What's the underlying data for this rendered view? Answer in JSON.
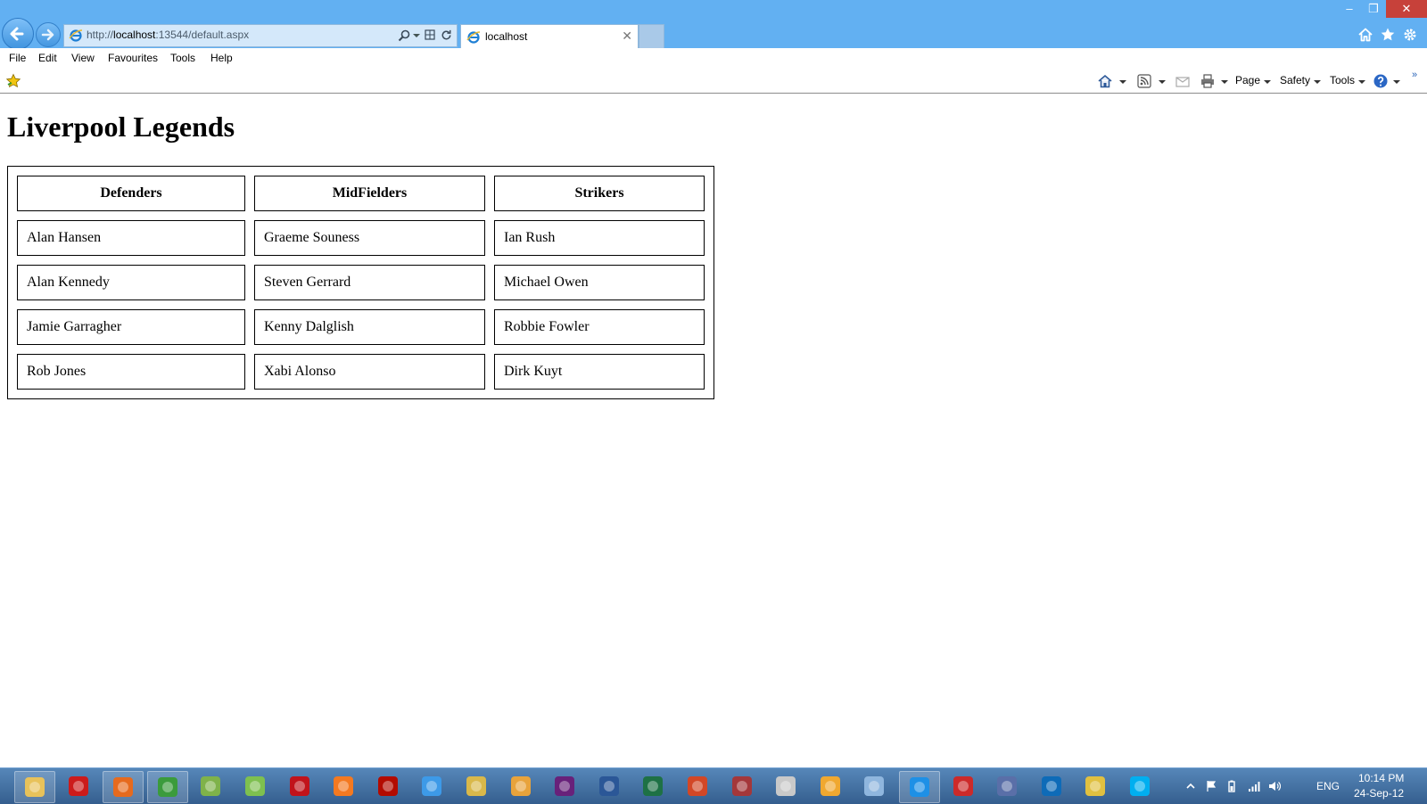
{
  "browser": {
    "address_scheme": "http://",
    "address_host": "localhost",
    "address_rest": ":13544/default.aspx",
    "tab_title": "localhost"
  },
  "menu": {
    "items": [
      {
        "label": "File"
      },
      {
        "label": "Edit"
      },
      {
        "label": "View"
      },
      {
        "label": "Favourites"
      },
      {
        "label": "Tools"
      },
      {
        "label": "Help"
      }
    ]
  },
  "commandbar": {
    "page_label": "Page",
    "safety_label": "Safety",
    "tools_label": "Tools"
  },
  "page": {
    "title": "Liverpool Legends",
    "table": {
      "headers": [
        "Defenders",
        "MidFielders",
        "Strikers"
      ],
      "rows": [
        [
          "Alan Hansen",
          "Graeme Souness",
          "Ian Rush"
        ],
        [
          "Alan Kennedy",
          "Steven Gerrard",
          "Michael Owen"
        ],
        [
          "Jamie Garragher",
          "Kenny Dalglish",
          "Robbie Fowler"
        ],
        [
          "Rob Jones",
          "Xabi Alonso",
          "Dirk Kuyt"
        ]
      ]
    }
  },
  "taskbar": {
    "apps": [
      {
        "name": "file-explorer-icon",
        "color": "#e8c25a",
        "running": true
      },
      {
        "name": "opera-icon",
        "color": "#cc1b1b",
        "running": false
      },
      {
        "name": "firefox-icon",
        "color": "#e66a1e",
        "running": true
      },
      {
        "name": "chrome-icon",
        "color": "#3b9b3c",
        "running": true
      },
      {
        "name": "paint-icon",
        "color": "#7fb24a",
        "running": false
      },
      {
        "name": "notepad-plus-icon",
        "color": "#7ec04f",
        "running": false
      },
      {
        "name": "filezilla-icon",
        "color": "#c1131b",
        "running": false
      },
      {
        "name": "media-player-icon",
        "color": "#f47920",
        "running": false
      },
      {
        "name": "acrobat-icon",
        "color": "#b30b00",
        "running": false
      },
      {
        "name": "dropbox-icon",
        "color": "#3d9ae8",
        "running": false
      },
      {
        "name": "tools-icon",
        "color": "#d9b84a",
        "running": false
      },
      {
        "name": "outlook-icon",
        "color": "#e8a33b",
        "running": false
      },
      {
        "name": "visual-studio-icon",
        "color": "#68217a",
        "running": false
      },
      {
        "name": "word-icon",
        "color": "#2b5797",
        "running": false
      },
      {
        "name": "excel-icon",
        "color": "#1e7145",
        "running": false
      },
      {
        "name": "powerpoint-icon",
        "color": "#d24726",
        "running": false
      },
      {
        "name": "access-icon",
        "color": "#a4373a",
        "running": false
      },
      {
        "name": "scanner-icon",
        "color": "#c9c9c9",
        "running": false
      },
      {
        "name": "palette-icon",
        "color": "#f0a830",
        "running": false
      },
      {
        "name": "remote-desktop-icon",
        "color": "#8fb6de",
        "running": false
      },
      {
        "name": "internet-explorer-icon",
        "color": "#1e90e6",
        "running": true
      },
      {
        "name": "snipping-tool-icon",
        "color": "#cc2a2a",
        "running": false
      },
      {
        "name": "sketch-icon",
        "color": "#5a6fa8",
        "running": false
      },
      {
        "name": "teamviewer-icon",
        "color": "#0e6bb8",
        "running": false
      },
      {
        "name": "settings-tools-icon",
        "color": "#e0c040",
        "running": false
      },
      {
        "name": "skype-icon",
        "color": "#00aff0",
        "running": false
      }
    ],
    "tray_lang": "ENG",
    "clock_time": "10:14 PM",
    "clock_date": "24-Sep-12"
  }
}
